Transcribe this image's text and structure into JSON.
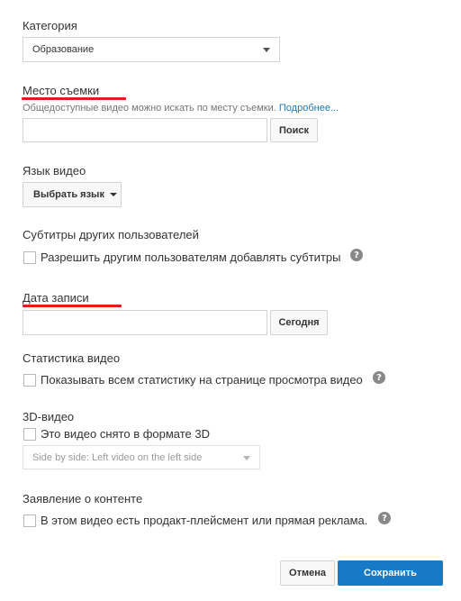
{
  "category": {
    "label": "Категория",
    "selected": "Образование"
  },
  "location": {
    "label": "Место съемки",
    "hint": "Общедоступные видео можно искать по месту съемки.",
    "hint_link": "Подробнее...",
    "value": "",
    "search_button": "Поиск",
    "underline_color": "#e8191c"
  },
  "language": {
    "label": "Язык видео",
    "button": "Выбрать язык"
  },
  "subtitles": {
    "label": "Субтитры других пользователей",
    "checkbox_label": "Разрешить другим пользователям добавлять субтитры",
    "checked": false
  },
  "recording_date": {
    "label": "Дата записи",
    "value": "",
    "today_button": "Сегодня",
    "underline_color": "#e8191c"
  },
  "statistics": {
    "label": "Статистика видео",
    "checkbox_label": "Показывать всем статистику на странице просмотра видео",
    "checked": false
  },
  "video3d": {
    "label": "3D-видео",
    "checkbox_label": "Это видео снято в формате 3D",
    "checked": false,
    "format_selected": "Side by side: Left video on the left side"
  },
  "content_declaration": {
    "label": "Заявление о контенте",
    "checkbox_label": "В этом видео есть продакт-плейсмент или прямая реклама.",
    "checked": false
  },
  "actions": {
    "cancel": "Отмена",
    "save": "Сохранить"
  },
  "help_glyph": "?",
  "colors": {
    "accent": "#167ac6",
    "link": "#167ac6",
    "marker": "#e8191c"
  }
}
